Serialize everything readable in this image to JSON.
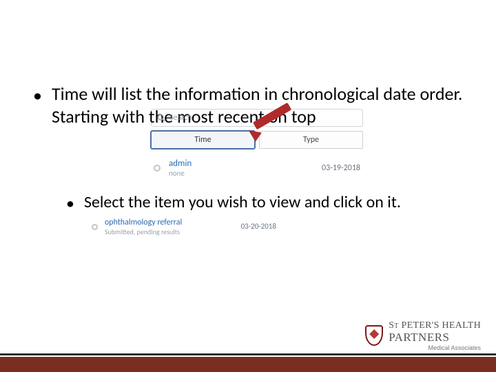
{
  "bullets": {
    "b1": "Time will list the information in chronological date order. Starting with the most recent on top",
    "b2_prefix": "Select the item you wish to view and click on it."
  },
  "screenshot1": {
    "search_placeholder": "Search",
    "tab_time": "Time",
    "tab_type": "Type",
    "entry_title": "admin",
    "entry_sub": "none",
    "entry_date": "03-19-2018"
  },
  "screenshot2": {
    "title": "ophthalmology referral",
    "sub": "Submitted, pending results",
    "date": "03-20-2018"
  },
  "logo": {
    "line_a_prefix": "S",
    "line_a_small": "T",
    "line_a_rest": " PETER'S HEALTH",
    "line_b": "PARTNERS",
    "line_c": "Medical Associates"
  }
}
